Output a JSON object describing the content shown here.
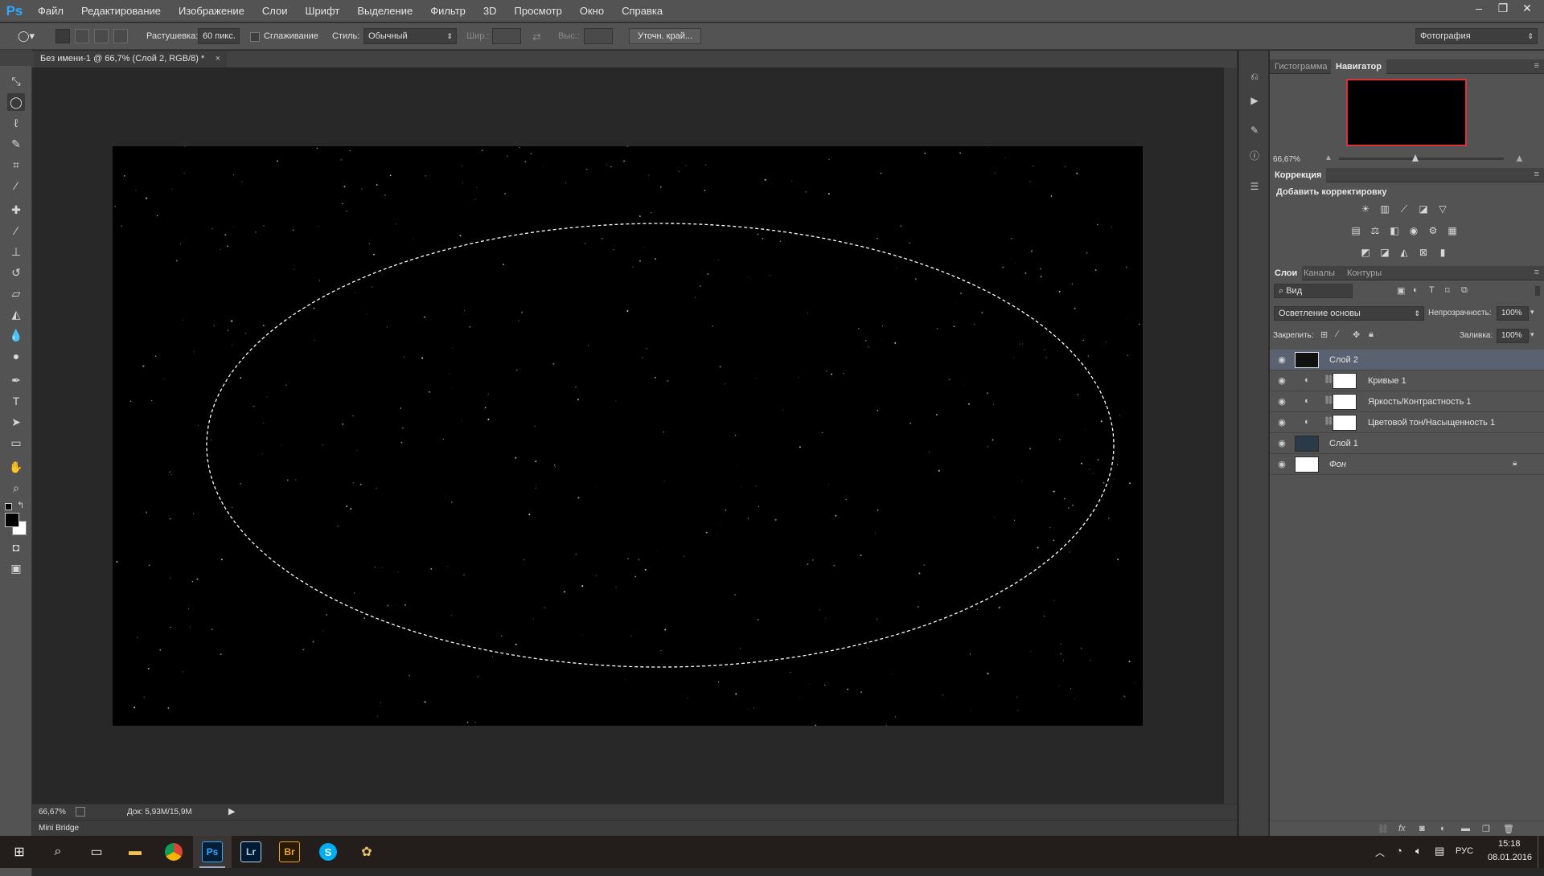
{
  "app": {
    "logo": "Ps"
  },
  "menu": [
    "Файл",
    "Редактирование",
    "Изображение",
    "Слои",
    "Шрифт",
    "Выделение",
    "Фильтр",
    "3D",
    "Просмотр",
    "Окно",
    "Справка"
  ],
  "window_controls": {
    "minimize": "–",
    "restore": "❐",
    "close": "✕"
  },
  "options": {
    "feather_label": "Растушевка:",
    "feather_value": "60 пикс.",
    "antialias_label": "Сглаживание",
    "style_label": "Стиль:",
    "style_value": "Обычный",
    "width_label": "Шир.:",
    "height_label": "Выс.:",
    "refine_edge": "Уточн. край...",
    "workspace": "Фотография"
  },
  "document": {
    "tab_title": "Без имени-1 @ 66,7% (Слой 2, RGB/8) *",
    "zoom": "66,67%",
    "doc_size": "Док: 5,93M/15,9M"
  },
  "minibridge": "Mini Bridge",
  "panels": {
    "top_tabs": [
      "Гистограмма",
      "Навигатор"
    ],
    "navigator_zoom": "66,67%",
    "correction_tab": "Коррекция",
    "add_adjustment": "Добавить корректировку",
    "layer_tabs": [
      "Слои",
      "Каналы",
      "Контуры"
    ],
    "filter_kind": "Вид",
    "blend_mode": "Осветление основы",
    "opacity_label": "Непрозрачность:",
    "opacity_value": "100%",
    "lock_label": "Закрепить:",
    "fill_label": "Заливка:",
    "fill_value": "100%"
  },
  "layers": [
    {
      "name": "Слой 2",
      "selected": true
    },
    {
      "name": "Кривые 1",
      "selected": false
    },
    {
      "name": "Яркость/Контрастность 1",
      "selected": false
    },
    {
      "name": "Цветовой тон/Насыщенность 1",
      "selected": false
    },
    {
      "name": "Слой 1",
      "selected": false
    },
    {
      "name": "Фон",
      "selected": false
    }
  ],
  "taskbar": {
    "lang": "РУС",
    "time": "15:18",
    "date": "08.01.2016",
    "apps": [
      "Ps",
      "Lr",
      "Br"
    ]
  },
  "colors": {
    "accent": "#31a8ff",
    "selected_layer": "#5a6272",
    "canvas": "#000000"
  }
}
